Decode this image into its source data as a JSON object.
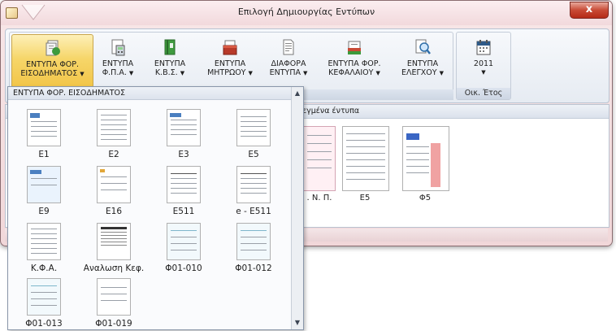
{
  "window": {
    "title": "Επιλογή Δημιουργίας Εντύπων",
    "close_label": "x"
  },
  "ribbon": {
    "buttons": [
      {
        "line1": "ΕΝΤΥΠΑ ΦΟΡ.",
        "line2": "ΕΙΣΟΔΗΜΑΤΟΣ",
        "icon": "income-tax-forms-icon",
        "active": true
      },
      {
        "line1": "ΕΝΤΥΠΑ",
        "line2": "Φ.Π.Α.",
        "icon": "vat-calculator-icon"
      },
      {
        "line1": "ΕΝΤΥΠΑ",
        "line2": "Κ.Β.Σ.",
        "icon": "books-binder-icon"
      },
      {
        "line1": "ΕΝΤΥΠΑ",
        "line2": "ΜΗΤΡΩΟΥ",
        "icon": "registry-folder-icon"
      },
      {
        "line1": "ΔΙΑΦΟΡΑ",
        "line2": "ΕΝΤΥΠΑ",
        "icon": "misc-document-icon"
      },
      {
        "line1": "ΕΝΤΥΠΑ ΦΟΡ.",
        "line2": "ΚΕΦΑΛΑΙΟΥ",
        "icon": "capital-tax-icon"
      },
      {
        "line1": "ΕΝΤΥΠΑ",
        "line2": "ΕΛΕΓΧΟΥ",
        "icon": "audit-magnifier-icon"
      }
    ],
    "year_button": {
      "label": "2011",
      "icon": "calendar-icon"
    },
    "year_group_label": "Οικ. Έτος"
  },
  "content": {
    "header_partial": "εγμένα έντυπα",
    "docs": [
      {
        "label": ". Ν. Π."
      },
      {
        "label": "Ε5"
      },
      {
        "label": "Φ5"
      }
    ]
  },
  "dropdown": {
    "header": "ΕΝΤΥΠΑ ΦΟΡ. ΕΙΣΟΔΗΜΑΤΟΣ",
    "items": [
      {
        "label": "Ε1"
      },
      {
        "label": "Ε2"
      },
      {
        "label": "Ε3"
      },
      {
        "label": "Ε5"
      },
      {
        "label": "Ε9"
      },
      {
        "label": "Ε16"
      },
      {
        "label": "Ε511"
      },
      {
        "label": "e - Ε511"
      },
      {
        "label": "Κ.Φ.Α."
      },
      {
        "label": "Αναλωση Κεφ."
      },
      {
        "label": "Φ01-010"
      },
      {
        "label": "Φ01-012"
      },
      {
        "label": "Φ01-013"
      },
      {
        "label": "Φ01-019"
      }
    ]
  },
  "colors": {
    "accent_active": "#f6d66a",
    "close_red": "#c84a35",
    "title_pink": "#f2d9dc"
  }
}
